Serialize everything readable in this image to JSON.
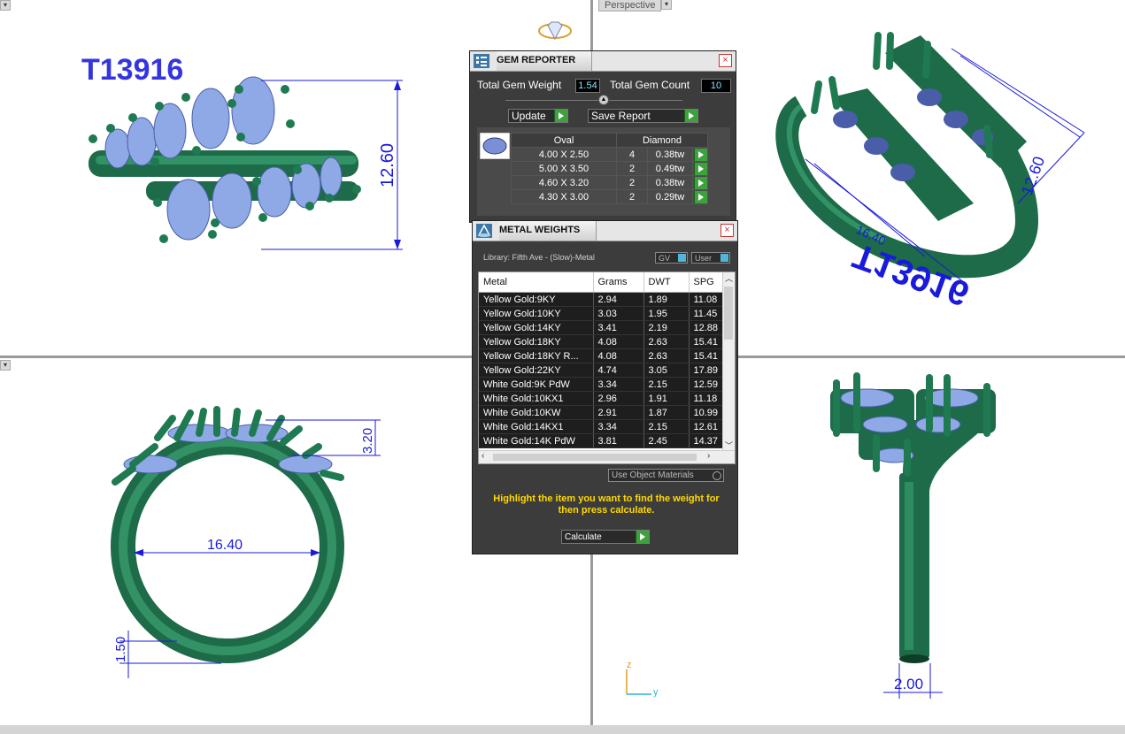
{
  "viewports": {
    "top_left": {
      "model_code": "T13916",
      "dimension_height": "12.60"
    },
    "top_right": {
      "label": "Perspective",
      "dimension_a": "12.60",
      "dimension_b": "16.40",
      "engraving": "T13916"
    },
    "bottom_left": {
      "dimension_inner": "16.40",
      "dimension_gem": "3.20",
      "dimension_band": "1.50"
    },
    "bottom_right": {
      "dimension_shank": "2.00",
      "axis_z": "z",
      "axis_y": "y"
    }
  },
  "gem_reporter": {
    "title": "GEM REPORTER",
    "total_weight_label": "Total Gem Weight",
    "total_weight_value": "1.54",
    "total_count_label": "Total Gem Count",
    "total_count_value": "10",
    "update_label": "Update",
    "save_label": "Save Report",
    "columns": [
      "Oval",
      "Diamond"
    ],
    "rows": [
      {
        "size": "4.00 X 2.50",
        "count": "4",
        "weight": "0.38tw"
      },
      {
        "size": "5.00 X 3.50",
        "count": "2",
        "weight": "0.49tw"
      },
      {
        "size": "4.60 X 3.20",
        "count": "2",
        "weight": "0.38tw"
      },
      {
        "size": "4.30 X 3.00",
        "count": "2",
        "weight": "0.29tw"
      }
    ]
  },
  "metal_weights": {
    "title": "METAL WEIGHTS",
    "library": "Library: Fifth Ave - (Slow)-Metal",
    "gv_label": "GV",
    "user_label": "User",
    "columns": [
      "Metal",
      "Grams",
      "DWT",
      "SPG"
    ],
    "rows": [
      {
        "metal": "Yellow Gold:9KY",
        "grams": "2.94",
        "dwt": "1.89",
        "spg": "11.08"
      },
      {
        "metal": "Yellow Gold:10KY",
        "grams": "3.03",
        "dwt": "1.95",
        "spg": "11.45"
      },
      {
        "metal": "Yellow Gold:14KY",
        "grams": "3.41",
        "dwt": "2.19",
        "spg": "12.88"
      },
      {
        "metal": "Yellow Gold:18KY",
        "grams": "4.08",
        "dwt": "2.63",
        "spg": "15.41"
      },
      {
        "metal": "Yellow Gold:18KY R...",
        "grams": "4.08",
        "dwt": "2.63",
        "spg": "15.41"
      },
      {
        "metal": "Yellow Gold:22KY",
        "grams": "4.74",
        "dwt": "3.05",
        "spg": "17.89"
      },
      {
        "metal": "White Gold:9K PdW",
        "grams": "3.34",
        "dwt": "2.15",
        "spg": "12.59"
      },
      {
        "metal": "White Gold:10KX1",
        "grams": "2.96",
        "dwt": "1.91",
        "spg": "11.18"
      },
      {
        "metal": "White Gold:10KW",
        "grams": "2.91",
        "dwt": "1.87",
        "spg": "10.99"
      },
      {
        "metal": "White Gold:14KX1",
        "grams": "3.34",
        "dwt": "2.15",
        "spg": "12.61"
      },
      {
        "metal": "White Gold:14K PdW",
        "grams": "3.81",
        "dwt": "2.45",
        "spg": "14.37"
      }
    ],
    "use_object_materials": "Use Object Materials",
    "hint": "Highlight the item you want to find the weight for then press calculate.",
    "calculate_label": "Calculate"
  },
  "colors": {
    "metal_green": "#1f7a52",
    "gem_blue": "#8fa8e6",
    "dimension_blue": "#1a1adb",
    "panel_bg": "#3c3c3c",
    "hint_yellow": "#ffd800"
  }
}
